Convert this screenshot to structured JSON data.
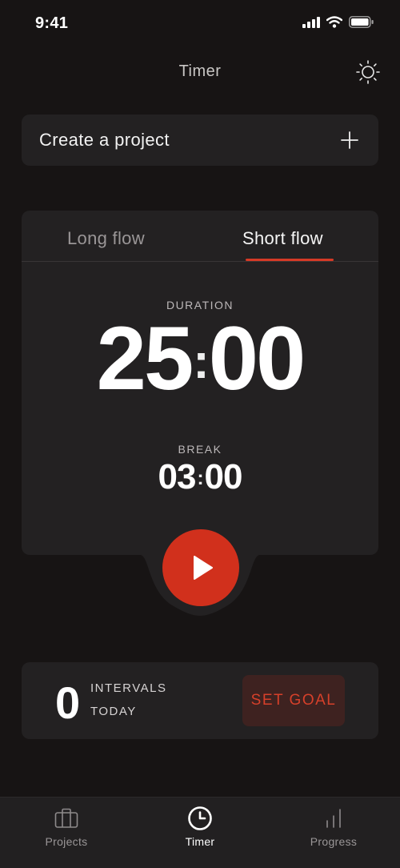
{
  "status_bar": {
    "time": "9:41"
  },
  "header": {
    "title": "Timer",
    "theme_icon": "sun-icon"
  },
  "create_project": {
    "label": "Create a project",
    "icon": "plus-icon"
  },
  "timer": {
    "tabs": [
      {
        "label": "Long flow",
        "active": false
      },
      {
        "label": "Short flow",
        "active": true
      }
    ],
    "duration_label": "DURATION",
    "duration_minutes": "25",
    "duration_seconds": "00",
    "break_label": "BREAK",
    "break_minutes": "03",
    "break_seconds": "00",
    "play_icon": "play-icon"
  },
  "stats": {
    "count": "0",
    "label_line1": "INTERVALS",
    "label_line2": "TODAY",
    "goal_button": "SET GOAL"
  },
  "tabbar": {
    "items": [
      {
        "label": "Projects",
        "icon": "briefcase-icon",
        "active": false
      },
      {
        "label": "Timer",
        "icon": "clock-icon",
        "active": true
      },
      {
        "label": "Progress",
        "icon": "bar-chart-icon",
        "active": false
      }
    ]
  },
  "colors": {
    "background": "#171414",
    "card": "#232122",
    "accent": "#d1301c",
    "goal_bg": "#3e2220"
  }
}
